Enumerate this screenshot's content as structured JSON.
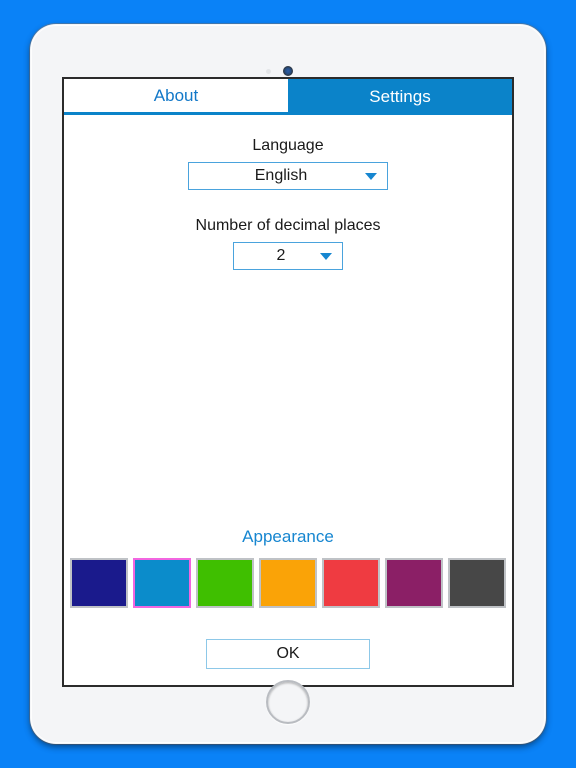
{
  "app": {
    "tabs": [
      {
        "label": "About",
        "active": false
      },
      {
        "label": "Settings",
        "active": true
      }
    ],
    "settings": {
      "language": {
        "label": "Language",
        "value": "English"
      },
      "decimals": {
        "label": "Number of decimal places",
        "value": "2"
      },
      "appearance": {
        "title": "Appearance",
        "swatches": [
          {
            "name": "navy",
            "color": "#1a1a8c",
            "selected": false
          },
          {
            "name": "blue",
            "color": "#0b8ccb",
            "selected": true
          },
          {
            "name": "green",
            "color": "#3fbf00",
            "selected": false
          },
          {
            "name": "orange",
            "color": "#faa307",
            "selected": false
          },
          {
            "name": "red",
            "color": "#ef3b41",
            "selected": false
          },
          {
            "name": "purple",
            "color": "#8b1f66",
            "selected": false
          },
          {
            "name": "gray",
            "color": "#474747",
            "selected": false
          }
        ]
      },
      "ok_button": "OK"
    }
  },
  "theme": {
    "background": "#0a82f7",
    "accent": "#0b83c9",
    "link": "#1686d0",
    "selection_border": "#f266e0"
  }
}
